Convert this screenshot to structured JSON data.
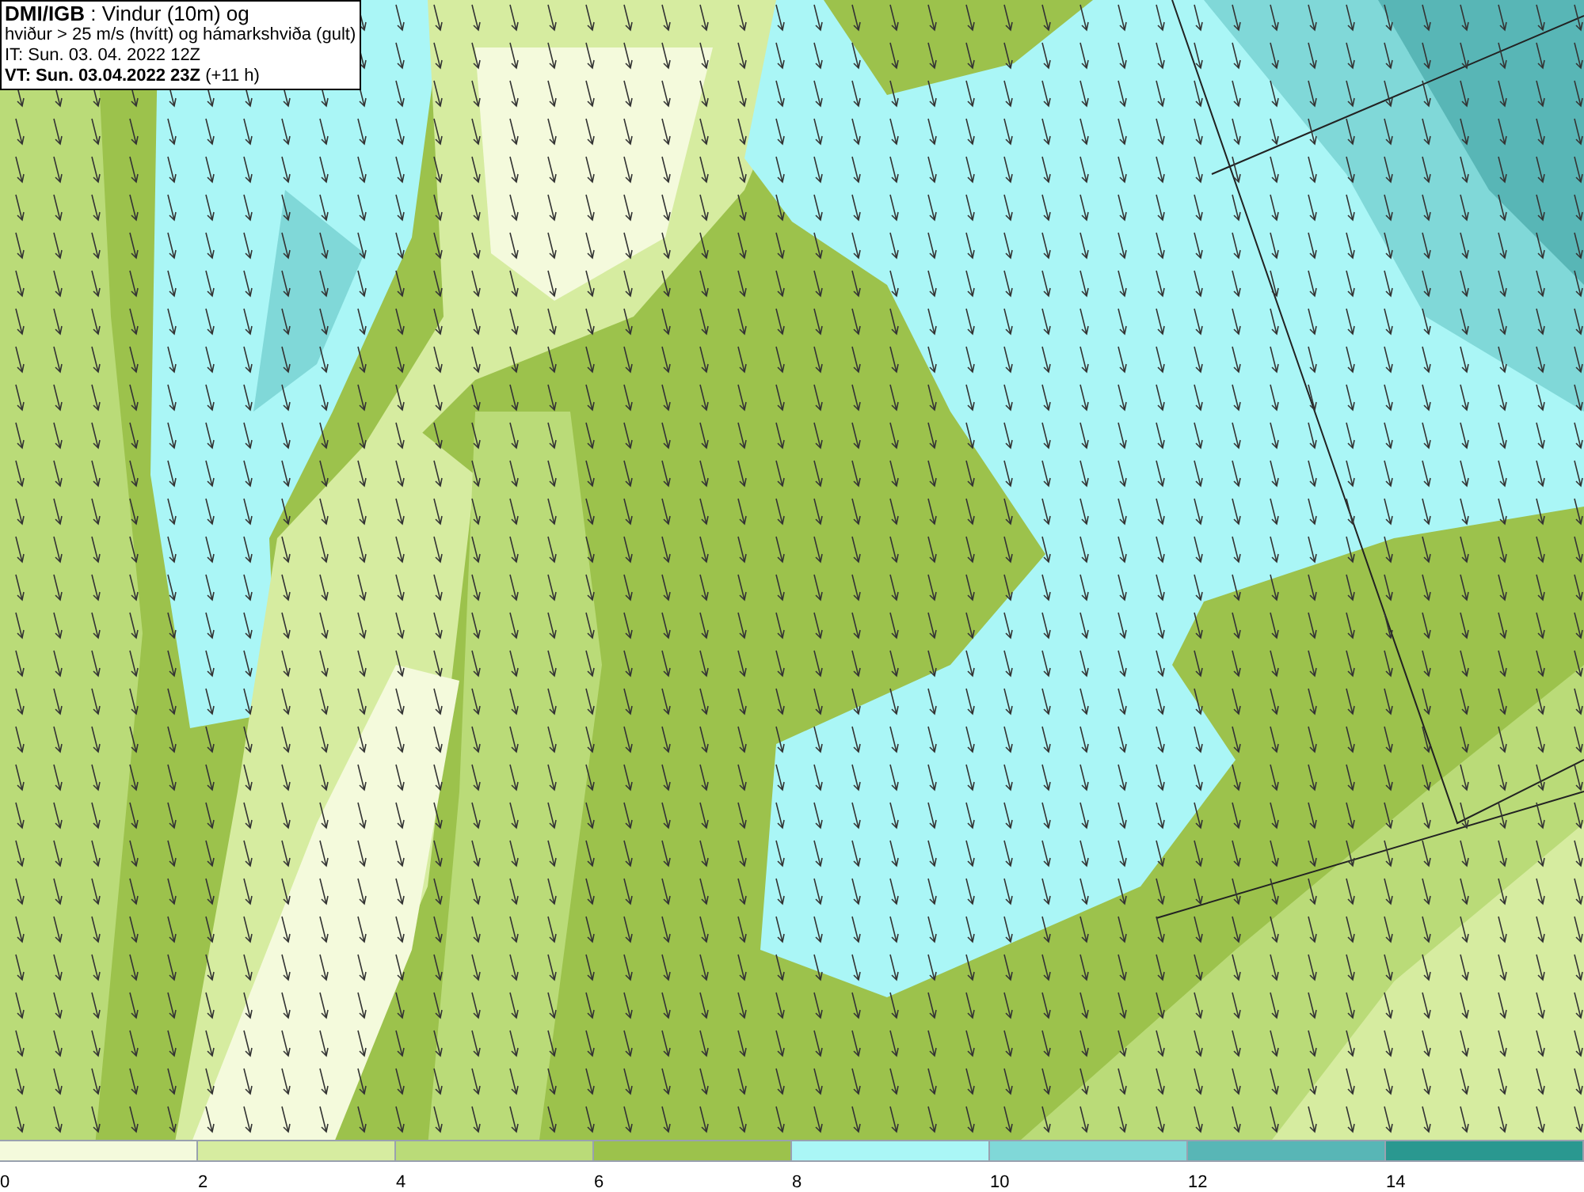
{
  "header": {
    "lines": [
      "**DMI/IGB** : Vindur (10m) og",
      "hviður > 25 m/s (hvítt) og hámarkshviða (gult)",
      "IT: Sun. 03. 04. 2022 12Z",
      "**VT: Sun. 03.04.2022 23Z** (+11 h)"
    ]
  },
  "legend": {
    "bins": [
      {
        "color": "#f4fadc",
        "label": "0"
      },
      {
        "color": "#d6eca0",
        "label": "2"
      },
      {
        "color": "#badb78",
        "label": "4"
      },
      {
        "color": "#9cc24c",
        "label": "6"
      },
      {
        "color": "#aaf6f6",
        "label": "8"
      },
      {
        "color": "#80d8d8",
        "label": "10"
      },
      {
        "color": "#58b6b6",
        "label": "12"
      },
      {
        "color": "#2a9890",
        "label": "14"
      }
    ]
  }
}
